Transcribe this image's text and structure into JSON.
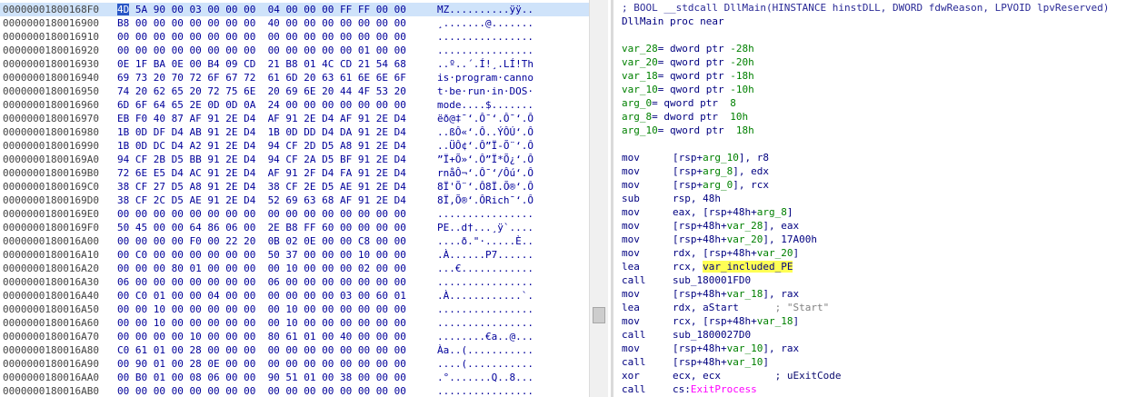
{
  "hex_view": {
    "rows": [
      {
        "offset": "00000001800168F0",
        "b0": "4D",
        "bytes": "5A 90 00 03 00 00 00  04 00 00 00 FF FF 00 00",
        "ascii": "MZ..........ÿÿ..",
        "selected": true
      },
      {
        "offset": "0000000180016900",
        "bytes": "B8 00 00 00 00 00 00 00  40 00 00 00 00 00 00 00",
        "ascii": "¸.......@......."
      },
      {
        "offset": "0000000180016910",
        "bytes": "00 00 00 00 00 00 00 00  00 00 00 00 00 00 00 00",
        "ascii": "................"
      },
      {
        "offset": "0000000180016920",
        "bytes": "00 00 00 00 00 00 00 00  00 00 00 00 00 01 00 00",
        "ascii": "................"
      },
      {
        "offset": "0000000180016930",
        "bytes": "0E 1F BA 0E 00 B4 09 CD  21 B8 01 4C CD 21 54 68",
        "ascii": "..º..´.Í!¸.LÍ!Th"
      },
      {
        "offset": "0000000180016940",
        "bytes": "69 73 20 70 72 6F 67 72  61 6D 20 63 61 6E 6E 6F",
        "ascii": "is·program·canno"
      },
      {
        "offset": "0000000180016950",
        "bytes": "74 20 62 65 20 72 75 6E  20 69 6E 20 44 4F 53 20",
        "ascii": "t·be·run·in·DOS·"
      },
      {
        "offset": "0000000180016960",
        "bytes": "6D 6F 64 65 2E 0D 0D 0A  24 00 00 00 00 00 00 00",
        "ascii": "mode....$......."
      },
      {
        "offset": "0000000180016970",
        "bytes": "EB F0 40 87 AF 91 2E D4  AF 91 2E D4 AF 91 2E D4",
        "ascii": "ëð@‡¯‘.Ô¯‘.Ô¯‘.Ô"
      },
      {
        "offset": "0000000180016980",
        "bytes": "1B 0D DF D4 AB 91 2E D4  1B 0D DD D4 DA 91 2E D4",
        "ascii": "..ßÔ«‘.Ô..ÝÔÚ‘.Ô"
      },
      {
        "offset": "0000000180016990",
        "bytes": "1B 0D DC D4 A2 91 2E D4  94 CF 2D D5 A8 91 2E D4",
        "ascii": "..ÜÔ¢‘.Ô”Ï-Õ¨‘.Ô"
      },
      {
        "offset": "00000001800169A0",
        "bytes": "94 CF 2B D5 BB 91 2E D4  94 CF 2A D5 BF 91 2E D4",
        "ascii": "”Ï+Õ»‘.Ô”Ï*Õ¿‘.Ô"
      },
      {
        "offset": "00000001800169B0",
        "bytes": "72 6E E5 D4 AC 91 2E D4  AF 91 2F D4 FA 91 2E D4",
        "ascii": "rnåÔ¬‘.Ô¯‘/Ôú‘.Ô"
      },
      {
        "offset": "00000001800169C0",
        "bytes": "38 CF 27 D5 A8 91 2E D4  38 CF 2E D5 AE 91 2E D4",
        "ascii": "8Ï'Õ¨‘.Ô8Ï.Õ®‘.Ô"
      },
      {
        "offset": "00000001800169D0",
        "bytes": "38 CF 2C D5 AE 91 2E D4  52 69 63 68 AF 91 2E D4",
        "ascii": "8Ï,Õ®‘.ÔRich¯‘.Ô"
      },
      {
        "offset": "00000001800169E0",
        "bytes": "00 00 00 00 00 00 00 00  00 00 00 00 00 00 00 00",
        "ascii": "................"
      },
      {
        "offset": "00000001800169F0",
        "bytes": "50 45 00 00 64 86 06 00  2E B8 FF 60 00 00 00 00",
        "ascii": "PE..d†...¸ÿ`...."
      },
      {
        "offset": "0000000180016A00",
        "bytes": "00 00 00 00 F0 00 22 20  0B 02 0E 00 00 C8 00 00",
        "ascii": "....ð.\"·.....È.."
      },
      {
        "offset": "0000000180016A10",
        "bytes": "00 C0 00 00 00 00 00 00  50 37 00 00 00 10 00 00",
        "ascii": ".À......P7......"
      },
      {
        "offset": "0000000180016A20",
        "bytes": "00 00 00 80 01 00 00 00  00 10 00 00 00 02 00 00",
        "ascii": "...€............"
      },
      {
        "offset": "0000000180016A30",
        "bytes": "06 00 00 00 00 00 00 00  06 00 00 00 00 00 00 00",
        "ascii": "................"
      },
      {
        "offset": "0000000180016A40",
        "bytes": "00 C0 01 00 00 04 00 00  00 00 00 00 03 00 60 01",
        "ascii": ".À............`."
      },
      {
        "offset": "0000000180016A50",
        "bytes": "00 00 10 00 00 00 00 00  00 10 00 00 00 00 00 00",
        "ascii": "................"
      },
      {
        "offset": "0000000180016A60",
        "bytes": "00 00 10 00 00 00 00 00  00 10 00 00 00 00 00 00",
        "ascii": "................"
      },
      {
        "offset": "0000000180016A70",
        "bytes": "00 00 00 00 10 00 00 00  80 61 01 00 40 00 00 00",
        "ascii": "........€a..@..."
      },
      {
        "offset": "0000000180016A80",
        "bytes": "C0 61 01 00 28 00 00 00  00 00 00 00 00 00 00 00",
        "ascii": "Àa..(..........."
      },
      {
        "offset": "0000000180016A90",
        "bytes": "00 90 01 00 28 0E 00 00  00 00 00 00 00 00 00 00",
        "ascii": "....(..........."
      },
      {
        "offset": "0000000180016AA0",
        "bytes": "00 B0 01 00 08 06 00 00  90 51 01 00 38 00 00 00",
        "ascii": ".°.......Q..8..."
      },
      {
        "offset": "0000000180016AB0",
        "bytes": "00 00 00 00 00 00 00 00  00 00 00 00 00 00 00 00",
        "ascii": "................"
      }
    ]
  },
  "disassembly": {
    "header_comment": "; BOOL __stdcall DllMain(HINSTANCE hinstDLL, DWORD fdwReason, LPVOID lpvReserved)",
    "proc_line": "DllMain proc near",
    "locals": [
      {
        "name": "var_28",
        "decl": "= dword ptr ",
        "value": "-28h"
      },
      {
        "name": "var_20",
        "decl": "= qword ptr ",
        "value": "-20h"
      },
      {
        "name": "var_18",
        "decl": "= qword ptr ",
        "value": "-18h"
      },
      {
        "name": "var_10",
        "decl": "= qword ptr ",
        "value": "-10h"
      },
      {
        "name": "arg_0",
        "decl": "= qword ptr  ",
        "value": "8"
      },
      {
        "name": "arg_8",
        "decl": "= dword ptr  ",
        "value": "10h"
      },
      {
        "name": "arg_10",
        "decl": "= qword ptr  ",
        "value": "18h"
      }
    ],
    "instructions": [
      {
        "m": "mov",
        "a": "[rsp+",
        "v": "arg_10",
        "b": "], r8"
      },
      {
        "m": "mov",
        "a": "[rsp+",
        "v": "arg_8",
        "b": "], edx"
      },
      {
        "m": "mov",
        "a": "[rsp+",
        "v": "arg_0",
        "b": "], rcx"
      },
      {
        "m": "sub",
        "a": "rsp, 48h",
        "v": "",
        "b": ""
      },
      {
        "m": "mov",
        "a": "eax, [rsp+48h+",
        "v": "arg_8",
        "b": "]"
      },
      {
        "m": "mov",
        "a": "[rsp+48h+",
        "v": "var_28",
        "b": "], eax"
      },
      {
        "m": "mov",
        "a": "[rsp+48h+",
        "v": "var_20",
        "b": "], 17A00h"
      },
      {
        "m": "mov",
        "a": "rdx, [rsp+48h+",
        "v": "var_20",
        "b": "]"
      },
      {
        "m": "lea",
        "a": "rcx, ",
        "hl": "var_included_PE",
        "v": "",
        "b": ""
      },
      {
        "m": "call",
        "a": "sub_180001FD0",
        "v": "",
        "b": ""
      },
      {
        "m": "mov",
        "a": "[rsp+48h+",
        "v": "var_18",
        "b": "], rax"
      },
      {
        "m": "lea",
        "a": "rdx, aStart",
        "v": "",
        "b": "",
        "c": "      ; \"Start\""
      },
      {
        "m": "mov",
        "a": "rcx, [rsp+48h+",
        "v": "var_18",
        "b": "]"
      },
      {
        "m": "call",
        "a": "sub_1800027D0",
        "v": "",
        "b": ""
      },
      {
        "m": "mov",
        "a": "[rsp+48h+",
        "v": "var_10",
        "b": "], rax"
      },
      {
        "m": "call",
        "a": "[rsp+48h+",
        "v": "var_10",
        "b": "]"
      },
      {
        "m": "xor",
        "a": "ecx, ecx",
        "v": "",
        "b": "",
        "c": "         ; uExitCode"
      },
      {
        "m": "call",
        "a": "cs:",
        "imp": "ExitProcess",
        "v": "",
        "b": ""
      }
    ]
  }
}
